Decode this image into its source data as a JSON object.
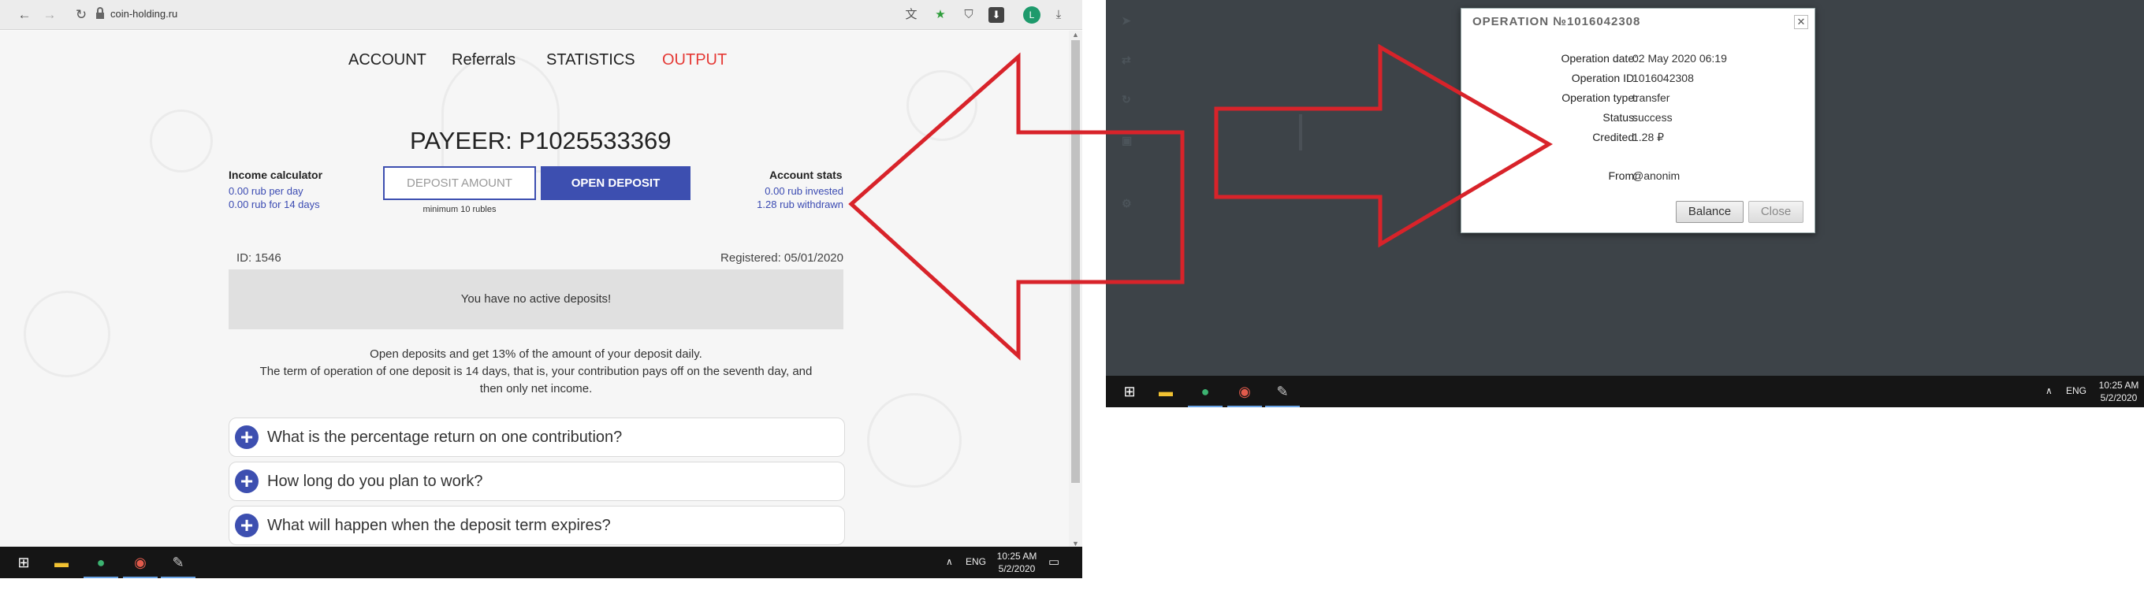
{
  "browser": {
    "url": "coin-holding.ru"
  },
  "site": {
    "nav": [
      "ACCOUNT",
      "Referrals",
      "STATISTICS",
      "OUTPUT"
    ],
    "payeer_title": "PAYEER: P1025533369",
    "income_calc": {
      "title": "Income calculator",
      "per_day": "0.00 rub per day",
      "per_14": "0.00 rub for 14 days"
    },
    "deposit": {
      "placeholder": "DEPOSIT AMOUNT",
      "button": "OPEN DEPOSIT",
      "min_note": "minimum 10 rubles"
    },
    "account_stats": {
      "title": "Account stats",
      "invested": "0.00 rub invested",
      "withdrawn": "1.28 rub withdrawn"
    },
    "id_label": "ID: 1546",
    "registered": "Registered: 05/01/2020",
    "no_deposits": "You have no active deposits!",
    "info_line1": "Open deposits and get 13% of the amount of your deposit daily.",
    "info_line2": "The term of operation of one deposit is 14 days, that is, your contribution pays off on the seventh day, and",
    "info_line3": "then only net income.",
    "faq": [
      "What is the percentage return on one contribution?",
      "How long do you plan to work?",
      "What will happen when the deposit term expires?"
    ]
  },
  "taskbar_left": {
    "lang": "ENG",
    "time": "10:25 AM",
    "date": "5/2/2020"
  },
  "taskbar_right": {
    "lang": "ENG",
    "time": "10:25 AM",
    "date": "5/2/2020"
  },
  "dialog": {
    "title": "OPERATION №1016042308",
    "rows": [
      {
        "label": "Operation date:",
        "value": "02 May 2020 06:19"
      },
      {
        "label": "Operation ID:",
        "value": "1016042308"
      },
      {
        "label": "Operation type:",
        "value": "transfer"
      },
      {
        "label": "Status:",
        "value": "success"
      },
      {
        "label": "Credited:",
        "value": "1.28 ₽"
      },
      {
        "label": "From:",
        "value": "@anonim"
      }
    ],
    "balance_btn": "Balance",
    "close_btn": "Close"
  },
  "colors": {
    "accent": "#3d4fb0",
    "output_red": "#e53935",
    "arrow_red": "#d8232a",
    "dark_bg": "#3d4348"
  }
}
